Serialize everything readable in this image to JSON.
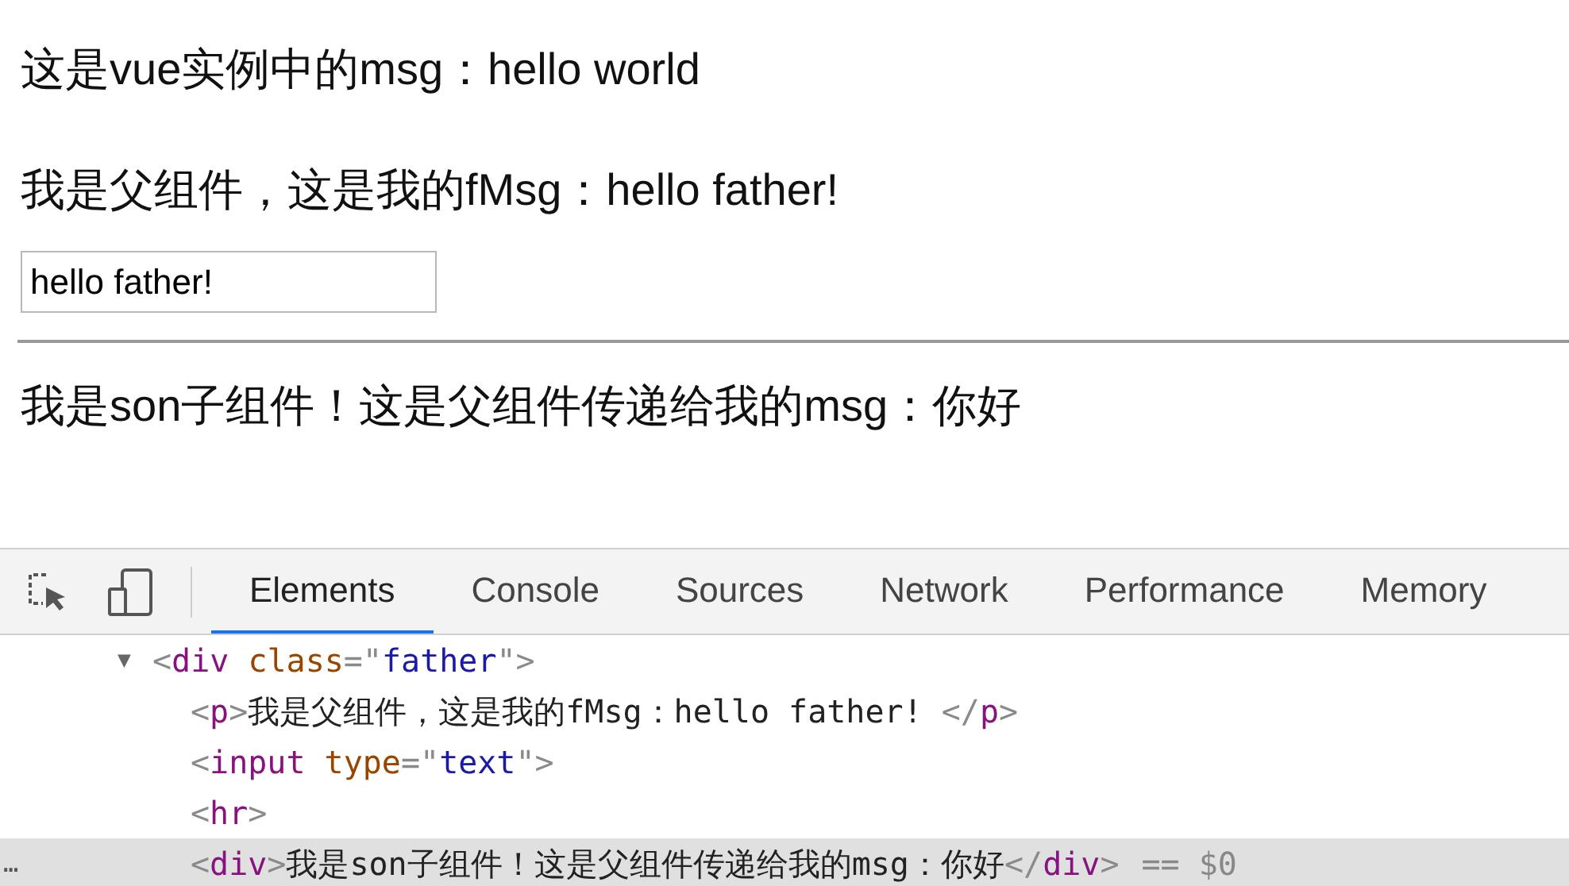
{
  "page": {
    "lines": [
      "这是vue实例中的msg：hello world",
      "我是父组件，这是我的fMsg：hello father!"
    ],
    "input": {
      "value": "hello father!"
    },
    "son_line": "我是son子组件！这是父组件传递给我的msg：你好"
  },
  "devtools": {
    "tabs": [
      {
        "label": "Elements",
        "selected": true
      },
      {
        "label": "Console",
        "selected": false
      },
      {
        "label": "Sources",
        "selected": false
      },
      {
        "label": "Network",
        "selected": false
      },
      {
        "label": "Performance",
        "selected": false
      },
      {
        "label": "Memory",
        "selected": false
      }
    ],
    "dom_lines": [
      {
        "arrow": "▼",
        "selected": false,
        "tokens": [
          {
            "kind": "punct",
            "text": "<"
          },
          {
            "kind": "tag",
            "text": "div"
          },
          {
            "kind": "attr",
            "text": "class"
          },
          {
            "kind": "punct",
            "text": "=\""
          },
          {
            "kind": "value",
            "text": "father"
          },
          {
            "kind": "punct",
            "text": "\">"
          }
        ]
      },
      {
        "selected": false,
        "tokens": [
          {
            "kind": "punct",
            "text": "<"
          },
          {
            "kind": "tag",
            "text": "p"
          },
          {
            "kind": "punct",
            "text": ">"
          },
          {
            "kind": "text",
            "text": "我是父组件，这是我的fMsg：hello father! "
          },
          {
            "kind": "punct",
            "text": "</"
          },
          {
            "kind": "tag",
            "text": "p"
          },
          {
            "kind": "punct",
            "text": ">"
          }
        ]
      },
      {
        "selected": false,
        "tokens": [
          {
            "kind": "punct",
            "text": "<"
          },
          {
            "kind": "tag",
            "text": "input"
          },
          {
            "kind": "attr",
            "text": "type"
          },
          {
            "kind": "punct",
            "text": "=\""
          },
          {
            "kind": "value",
            "text": "text"
          },
          {
            "kind": "punct",
            "text": "\">"
          }
        ]
      },
      {
        "selected": false,
        "tokens": [
          {
            "kind": "punct",
            "text": "<"
          },
          {
            "kind": "tag",
            "text": "hr"
          },
          {
            "kind": "punct",
            "text": ">"
          }
        ]
      },
      {
        "gutter": "…",
        "selected": true,
        "suffix": "== $0",
        "tokens": [
          {
            "kind": "punct",
            "text": "<"
          },
          {
            "kind": "tag",
            "text": "div"
          },
          {
            "kind": "punct",
            "text": ">"
          },
          {
            "kind": "text",
            "text": "我是son子组件！这是父组件传递给我的msg：你好"
          },
          {
            "kind": "punct",
            "text": "</"
          },
          {
            "kind": "tag",
            "text": "div"
          },
          {
            "kind": "punct",
            "text": ">"
          }
        ]
      }
    ]
  }
}
